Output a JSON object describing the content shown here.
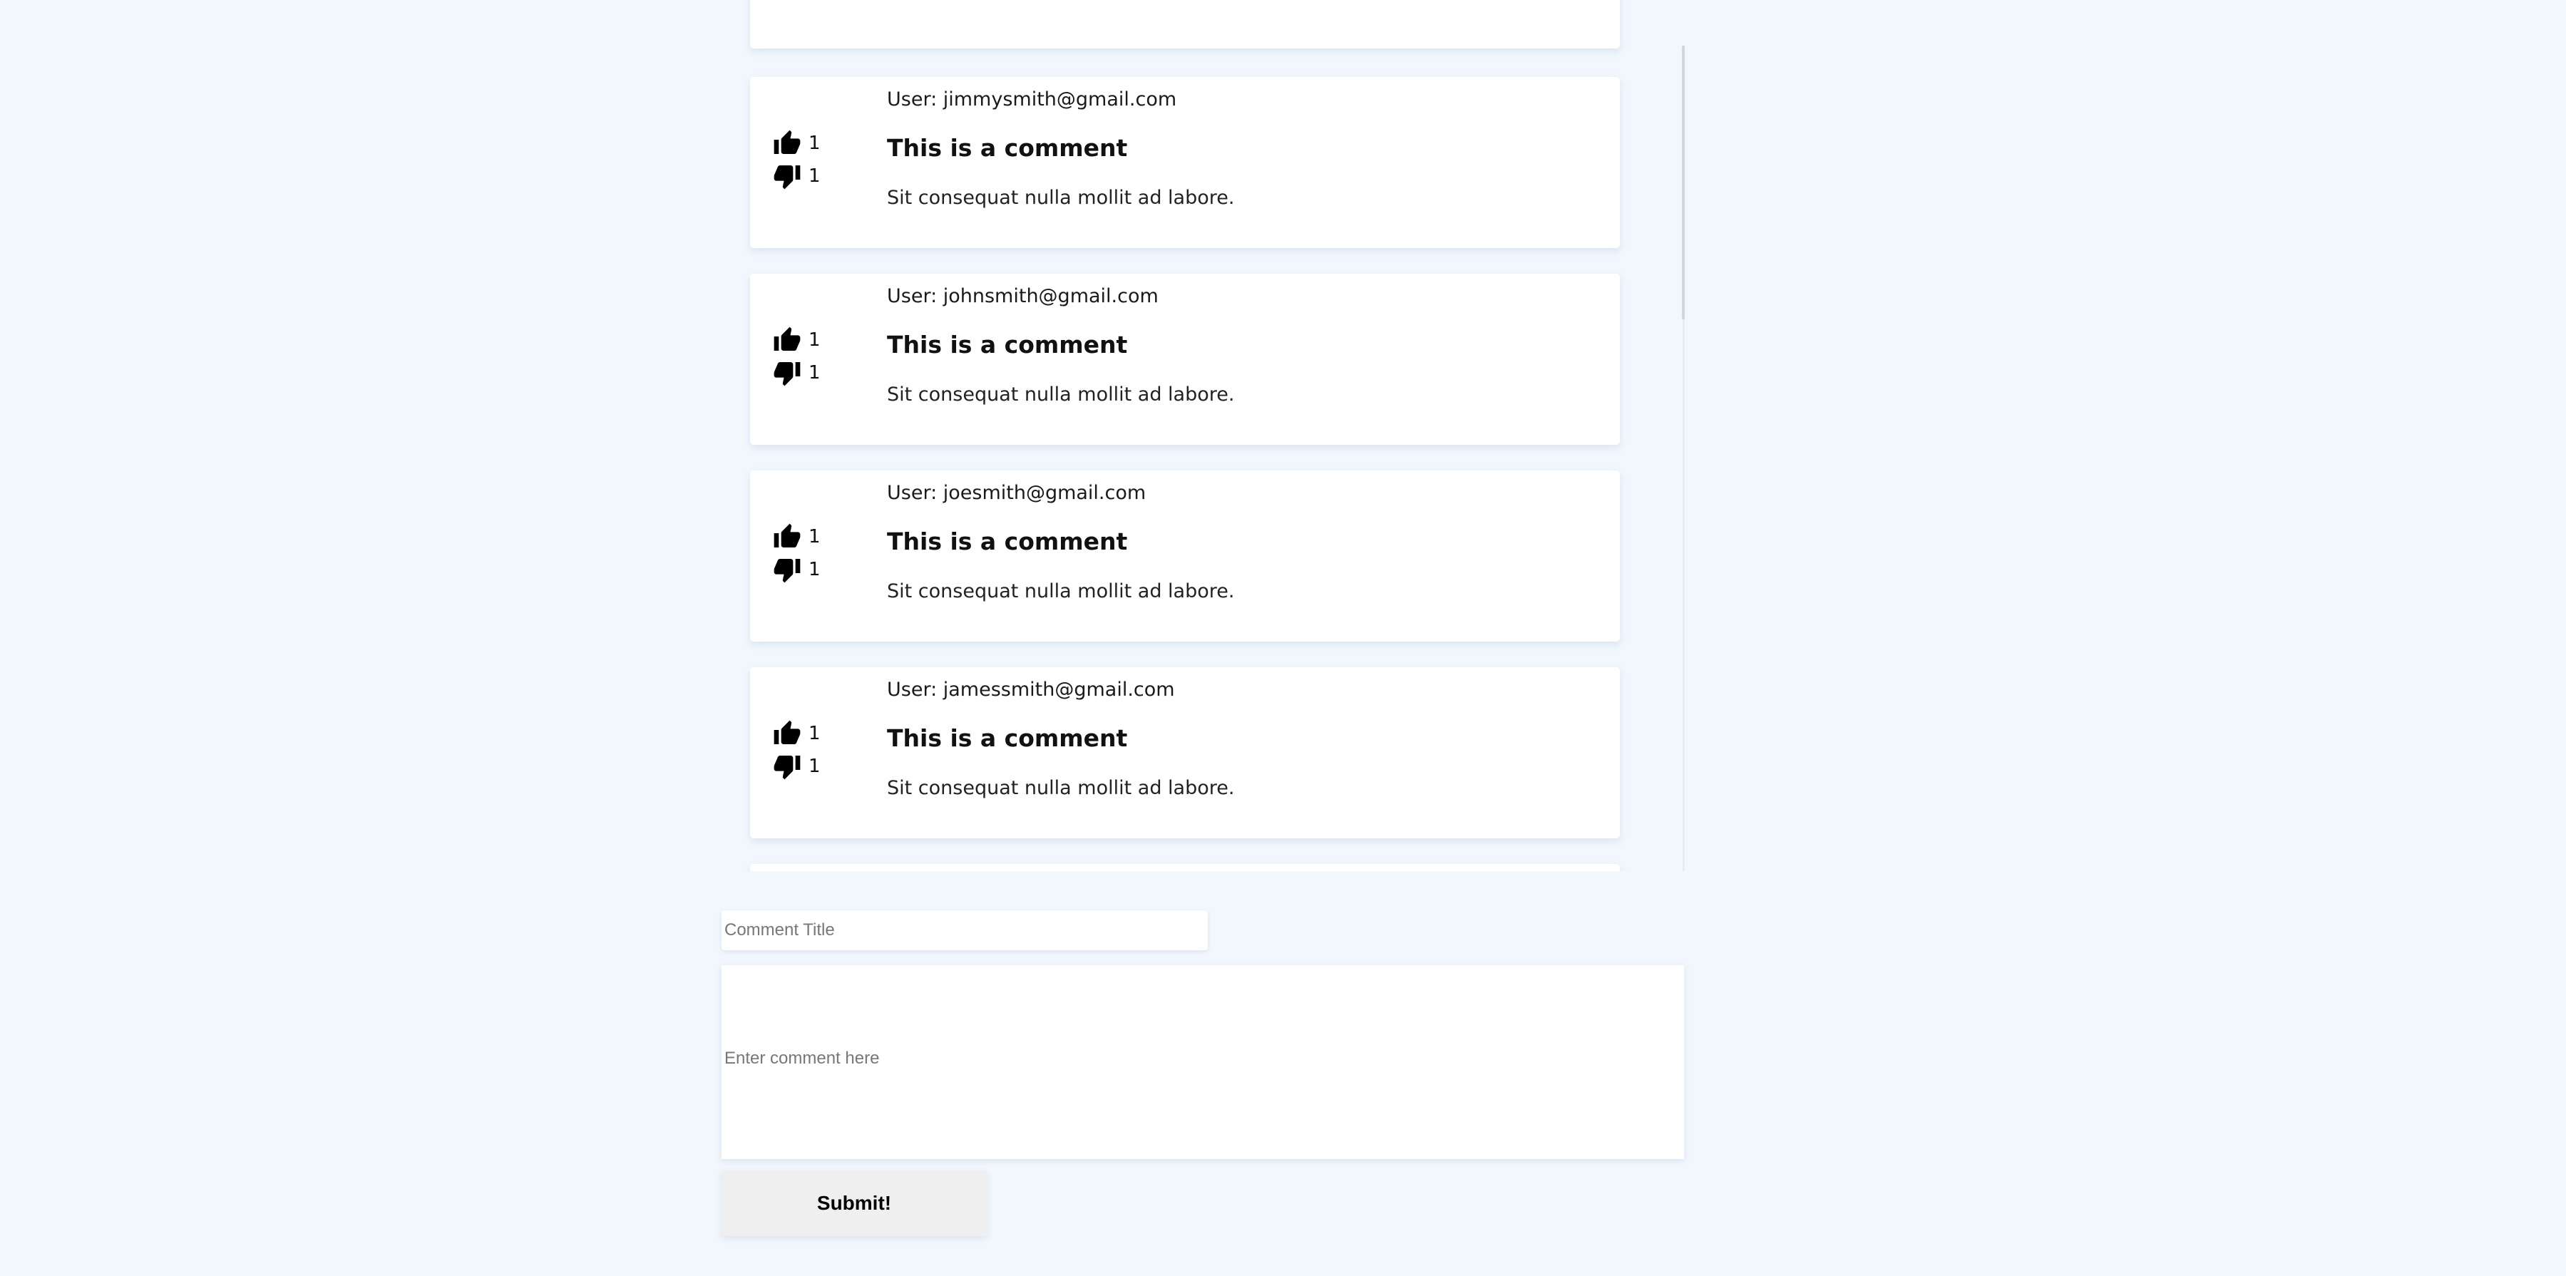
{
  "comments": [
    {
      "user": "User: jimmysmith@gmail.com",
      "title": "This is a comment",
      "text": "Sit consequat nulla mollit ad labore.",
      "likes": "1",
      "dislikes": "1"
    },
    {
      "user": "User: johnsmith@gmail.com",
      "title": "This is a comment",
      "text": "Sit consequat nulla mollit ad labore.",
      "likes": "1",
      "dislikes": "1"
    },
    {
      "user": "User: joesmith@gmail.com",
      "title": "This is a comment",
      "text": "Sit consequat nulla mollit ad labore.",
      "likes": "1",
      "dislikes": "1"
    },
    {
      "user": "User: jamessmith@gmail.com",
      "title": "This is a comment",
      "text": "Sit consequat nulla mollit ad labore.",
      "likes": "1",
      "dislikes": "1"
    }
  ],
  "icons": {
    "like": "thumbs-up-icon",
    "dislike": "thumbs-down-icon"
  },
  "form": {
    "title_placeholder": "Comment Title",
    "title_value": "",
    "comment_placeholder": "Enter comment here",
    "comment_value": "",
    "submit_label": "Submit!"
  },
  "colors": {
    "page_background": "#f2f7fd",
    "card_background": "#ffffff",
    "button_background": "#efefef"
  }
}
